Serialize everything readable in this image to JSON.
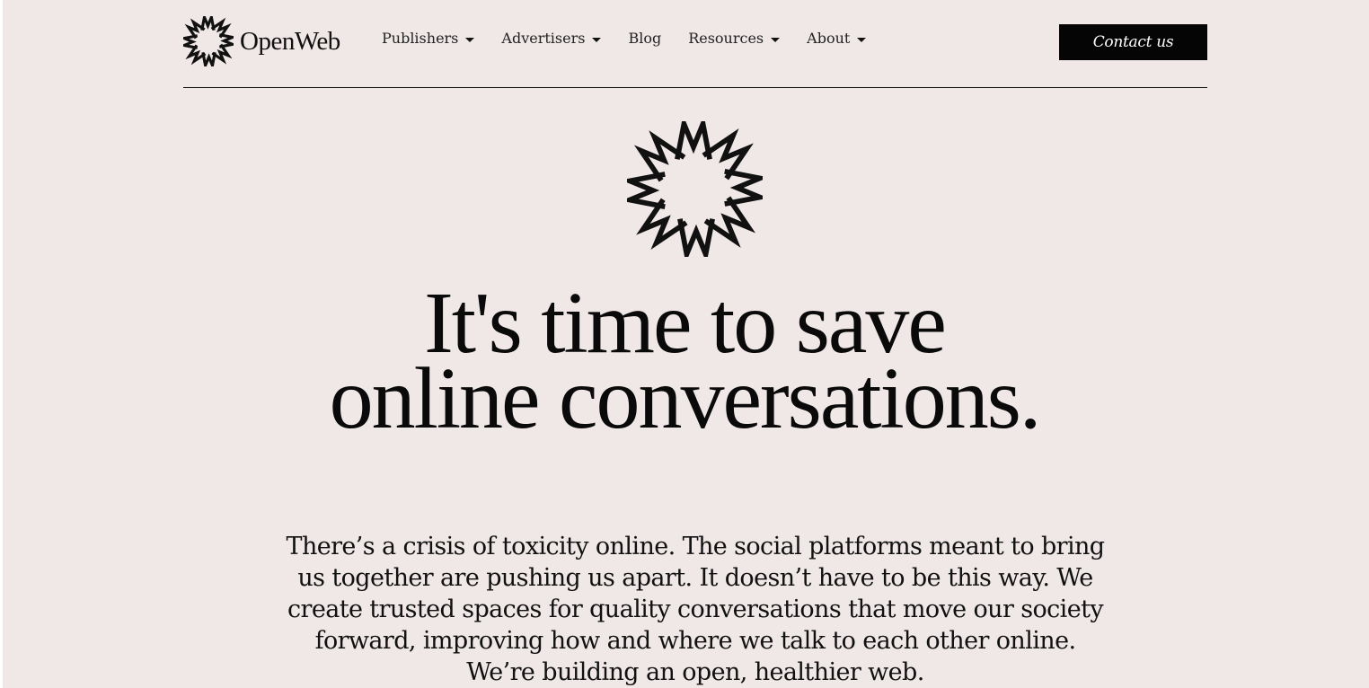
{
  "brand": {
    "name": "OpenWeb",
    "logo_icon": "openweb-burst-icon"
  },
  "nav": {
    "items": [
      {
        "label": "Publishers",
        "has_dropdown": true
      },
      {
        "label": "Advertisers",
        "has_dropdown": true
      },
      {
        "label": "Blog",
        "has_dropdown": false
      },
      {
        "label": "Resources",
        "has_dropdown": true
      },
      {
        "label": "About",
        "has_dropdown": true
      }
    ],
    "cta_label": "Contact us"
  },
  "hero": {
    "headline_line1": "It's time to save",
    "headline_line2": "online conversations.",
    "body": "There’s a crisis of toxicity online. The social platforms meant to bring us together are pushing us apart. It doesn’t have to be this way. We create trusted spaces for quality conversations that move our society forward, improving how and where we talk to each other online. We’re building an open, healthier web."
  },
  "colors": {
    "background": "#f0e8e6",
    "text": "#111111",
    "cta_background": "#050505",
    "cta_text": "#ffffff"
  }
}
